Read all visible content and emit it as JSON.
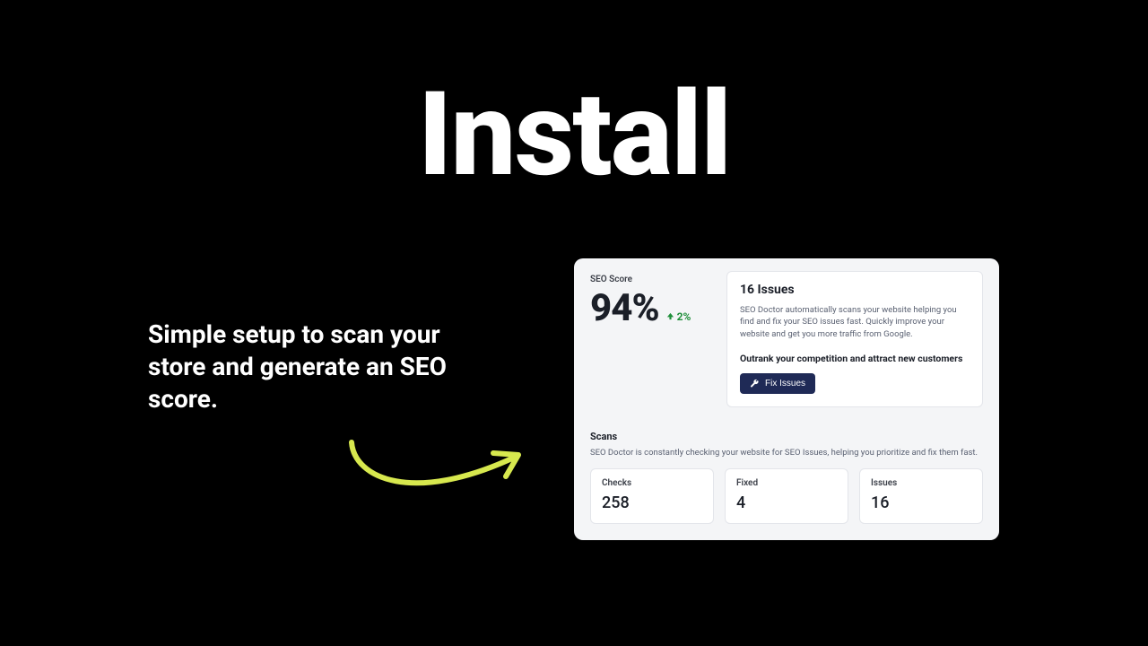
{
  "hero": {
    "title": "Install",
    "subhead": "Simple setup to scan your store and generate an SEO score."
  },
  "dashboard": {
    "score": {
      "label": "SEO Score",
      "value": "94%",
      "delta": "2%"
    },
    "issues": {
      "title": "16 Issues",
      "description": "SEO Doctor automatically scans your website helping you find and fix your SEO issues fast. Quickly improve your website and get you more traffic from Google.",
      "outrank": "Outrank your competition and attract new customers",
      "button": "Fix Issues"
    },
    "scans": {
      "title": "Scans",
      "description": "SEO Doctor is constantly checking your website for SEO Issues, helping you prioritize and fix them fast.",
      "stats": [
        {
          "label": "Checks",
          "value": "258"
        },
        {
          "label": "Fixed",
          "value": "4"
        },
        {
          "label": "Issues",
          "value": "16"
        }
      ]
    }
  },
  "colors": {
    "accent_green": "#1f8f3a",
    "button_bg": "#1f2a56",
    "arrow": "#d7e84e"
  }
}
